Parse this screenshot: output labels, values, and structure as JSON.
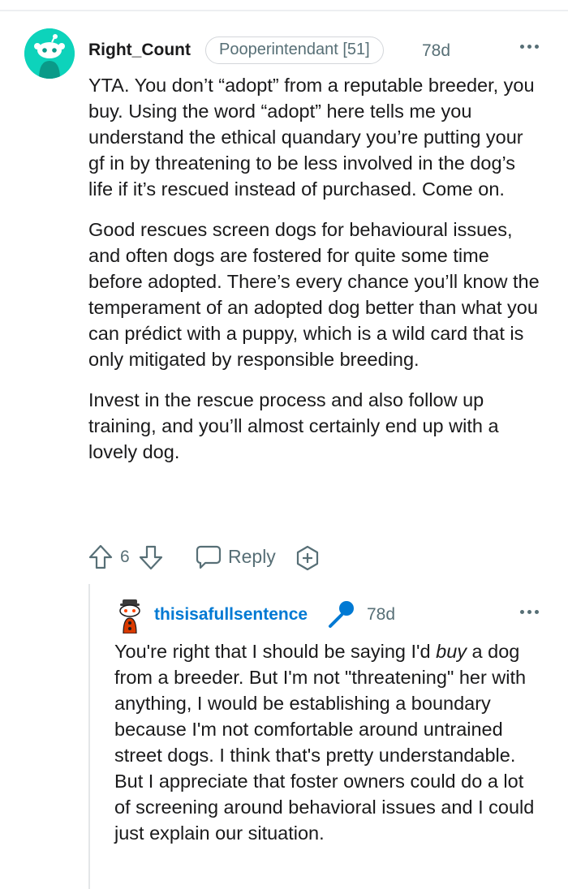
{
  "comment": {
    "username": "Right_Count",
    "flair": "Pooperintendant [51]",
    "age": "78d",
    "paragraphs": [
      "YTA. You don’t “adopt” from a reputable breeder, you buy. Using the word “adopt” here tells me you understand the ethical quandary you’re putting your gf in by threatening to be less involved in the dog’s life if it’s rescued instead of purchased. Come on.",
      "Good rescues screen dogs for behavioural issues, and often dogs are fostered for quite some time before adopted. There’s every chance you’ll know the temperament of an adopted dog better than what you can prédict with a puppy, which is a wild card that is only mitigated by responsible breeding.",
      "Invest in the rescue process and also follow up training, and you’ll almost certainly end up with a lovely dog."
    ],
    "vote_count": "6",
    "reply_label": "Reply"
  },
  "reply": {
    "username": "thisisafullsentence",
    "age": "78d",
    "text_before": "You're right that I should be saying I'd ",
    "text_emphasis": "buy",
    "text_after": " a dog from a breeder. But I'm not \"threatening\" her with anything, I would be establishing a boundary because I'm not comfortable around untrained street dogs. I think that's pretty understandable. But I appreciate that foster owners could do a lot of screening around behavioral issues and I could just explain our situation."
  },
  "colors": {
    "avatar_bg": "#0dd3bb",
    "reply_username": "#0079d3",
    "meta_gray": "#576f76"
  }
}
